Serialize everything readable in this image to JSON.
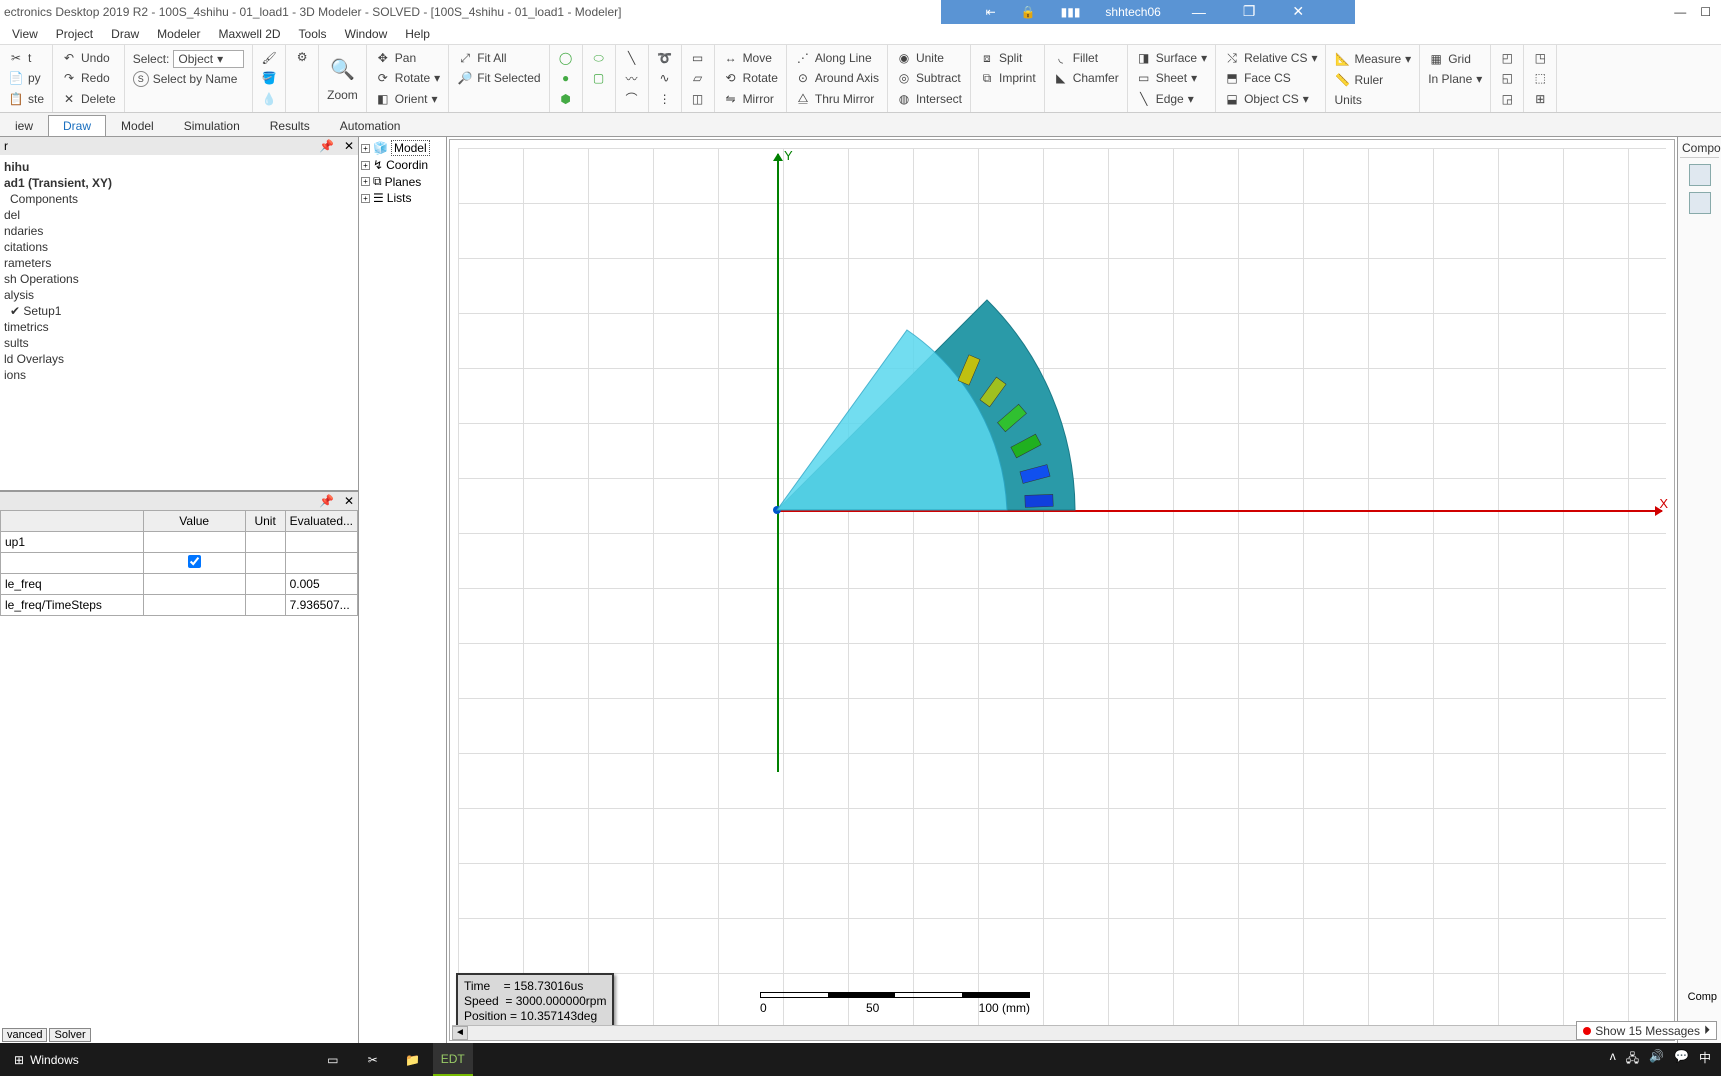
{
  "title": "ectronics Desktop 2019 R2 - 100S_4shihu - 01_load1 - 3D Modeler - SOLVED - [100S_4shihu - 01_load1 - Modeler]",
  "remote_host": "shhtech06",
  "menu": [
    "View",
    "Project",
    "Draw",
    "Modeler",
    "Maxwell 2D",
    "Tools",
    "Window",
    "Help"
  ],
  "ribbon": {
    "undo": "Undo",
    "redo": "Redo",
    "copy": "py",
    "paste": "ste",
    "delete": "Delete",
    "select_label": "Select:",
    "select_value": "Object",
    "select_by_name": "Select by Name",
    "zoom": "Zoom",
    "pan": "Pan",
    "rotate": "Rotate",
    "orient": "Orient",
    "fit_all": "Fit All",
    "fit_selected": "Fit Selected",
    "move": "Move",
    "rotate2": "Rotate",
    "mirror": "Mirror",
    "along_line": "Along Line",
    "around_axis": "Around Axis",
    "thru_mirror": "Thru Mirror",
    "unite": "Unite",
    "subtract": "Subtract",
    "intersect": "Intersect",
    "split": "Split",
    "imprint": "Imprint",
    "fillet": "Fillet",
    "chamfer": "Chamfer",
    "surface": "Surface",
    "sheet": "Sheet",
    "edge": "Edge",
    "relative_cs": "Relative CS",
    "face_cs": "Face CS",
    "object_cs": "Object CS",
    "measure": "Measure",
    "ruler": "Ruler",
    "units": "Units",
    "grid": "Grid",
    "in_plane": "In Plane"
  },
  "subtabs": [
    "iew",
    "Draw",
    "Model",
    "Simulation",
    "Results",
    "Automation"
  ],
  "subtab_active": 1,
  "proj_tree": {
    "root": "hihu",
    "design": "ad1 (Transient, XY)",
    "items": [
      "Components",
      "del",
      "ndaries",
      "citations",
      "rameters",
      "sh Operations",
      "alysis",
      "Setup1",
      "timetrics",
      "sults",
      "ld Overlays",
      "ions"
    ]
  },
  "props": {
    "headers": [
      "",
      "Value",
      "Unit",
      "Evaluated..."
    ],
    "rows": [
      {
        "name": "up1",
        "value": "",
        "unit": "",
        "eval": ""
      },
      {
        "name": "",
        "value": "☑",
        "unit": "",
        "eval": ""
      },
      {
        "name": "le_freq",
        "value": "",
        "unit": "",
        "eval": "0.005"
      },
      {
        "name": "le_freq/TimeSteps",
        "value": "",
        "unit": "",
        "eval": "7.936507..."
      }
    ],
    "tabs": [
      "vanced",
      "Solver"
    ]
  },
  "model_tree": [
    "Model",
    "Coordin",
    "Planes",
    "Lists"
  ],
  "overlay": {
    "time_label": "Time",
    "time_val": "= 158.73016us",
    "speed_label": "Speed",
    "speed_val": "= 3000.000000rpm",
    "pos_label": "Position",
    "pos_val": "= 10.357143deg"
  },
  "scale": {
    "t0": "0",
    "t1": "50",
    "t2": "100 (mm)"
  },
  "axis": {
    "x": "X",
    "y": "Y"
  },
  "right_panel_title": "Compor",
  "right_panel_bottom": "Comp",
  "messages": "Show 15 Messages",
  "taskbar": {
    "start": "Windows"
  }
}
